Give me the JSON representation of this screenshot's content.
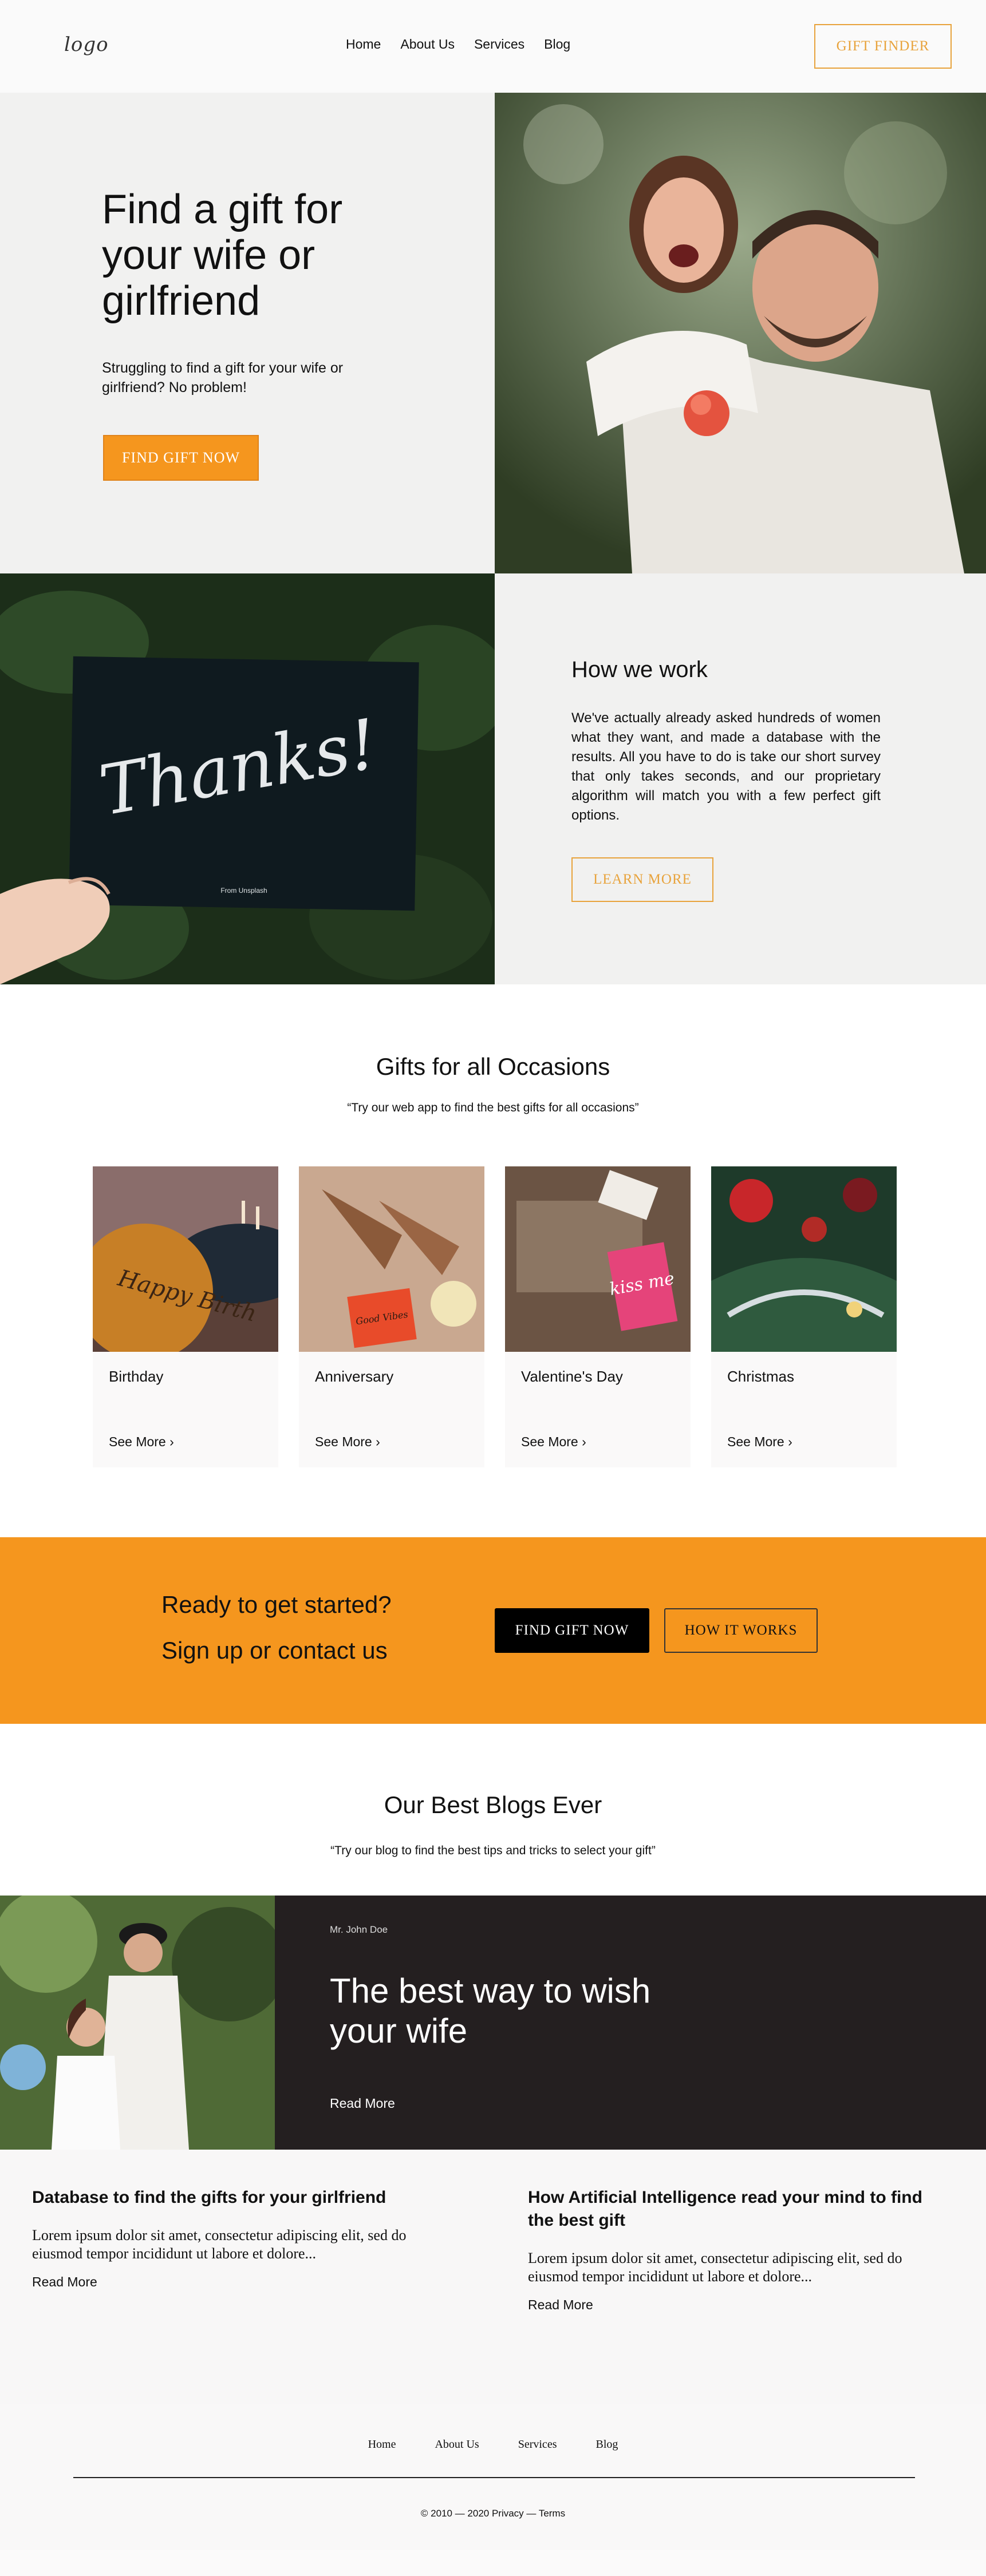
{
  "header": {
    "logo": "logo",
    "nav": [
      "Home",
      "About Us",
      "Services",
      "Blog"
    ],
    "cta": "GIFT FINDER"
  },
  "hero": {
    "title": "Find a gift for your wife or girlfriend",
    "subtitle": "Struggling to find a gift for your wife or girlfriend? No problem!",
    "cta": "FIND GIFT NOW"
  },
  "how": {
    "card_text": "Thanks!",
    "card_caption": "From Unsplash",
    "title": "How we work",
    "text": "We've actually already asked hundreds of women what they want, and made a database with the results. All you have to do is take our short survey that only takes seconds, and our proprietary algorithm will match you with a few perfect gift options.",
    "cta": "LEARN MORE"
  },
  "occasions": {
    "title": "Gifts for all Occasions",
    "subtitle": "“Try our web app to find the best gifts for all occasions”",
    "cards": [
      {
        "title": "Birthday",
        "link": "See More ›",
        "image_text": "Happy Birth"
      },
      {
        "title": "Anniversary",
        "link": "See More ›",
        "image_text": "Good Vibes"
      },
      {
        "title": "Valentine's Day",
        "link": "See More ›",
        "image_text": "kiss me"
      },
      {
        "title": "Christmas",
        "link": "See More ›",
        "image_text": ""
      }
    ]
  },
  "cta_band": {
    "line1": "Ready to get started?",
    "line2": "Sign up or contact us",
    "primary": "FIND GIFT NOW",
    "secondary": "HOW IT WORKS"
  },
  "blogs": {
    "title": "Our Best Blogs Ever",
    "subtitle": "“Try our blog to find the best tips and tricks to select your gift”",
    "feature": {
      "author": "Mr. John Doe",
      "title": "The best way to wish your wife",
      "link": "Read More"
    },
    "posts": [
      {
        "title": "Database to find the gifts for your girlfriend",
        "text": "Lorem ipsum dolor sit amet, consectetur adipiscing elit, sed do eiusmod tempor incididunt ut labore et dolore...",
        "link": "Read More"
      },
      {
        "title": "How Artificial Intelligence read your mind to find the best gift",
        "text": "Lorem ipsum dolor sit amet, consectetur adipiscing elit, sed do eiusmod tempor incididunt ut labore et dolore...",
        "link": "Read More"
      }
    ]
  },
  "footer": {
    "nav": [
      "Home",
      "About Us",
      "Services",
      "Blog"
    ],
    "copyright": "© 2010 — 2020 Privacy — Terms"
  }
}
